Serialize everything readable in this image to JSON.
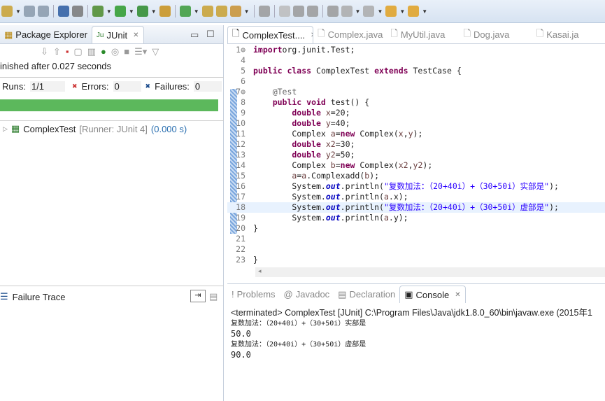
{
  "toolbar": {
    "icons": [
      "new-icon",
      "save-icon",
      "save-all-icon",
      "console-icon",
      "skip-breakpoints-icon",
      "debug-icon",
      "run-icon",
      "coverage-icon",
      "new-package-icon",
      "refresh-icon",
      "open-type-icon",
      "open-folder-icon",
      "tool-icon",
      "pin-icon",
      "search-icon",
      "mark-occurrences-icon",
      "block-selection-icon",
      "show-whitespace-icon",
      "next-annotation-icon",
      "prev-annotation-icon",
      "back-icon",
      "forward-icon"
    ]
  },
  "left": {
    "tabs": [
      {
        "label": "Package Explorer"
      },
      {
        "label": "JUnit"
      }
    ],
    "status": "inished after 0.027 seconds",
    "runs_label": "Runs:",
    "runs": "1/1",
    "errors_label": "Errors:",
    "errors": "0",
    "failures_label": "Failures:",
    "failures": "0",
    "progress": 1.0,
    "progress_color": "#5cb85c",
    "tree_item": {
      "name": "ComplexTest",
      "runner": "[Runner: JUnit 4]",
      "time": "(0.000 s)"
    },
    "failure_trace": "Failure Trace"
  },
  "editor": {
    "tabs": [
      {
        "label": "ComplexTest...."
      },
      {
        "label": "Complex.java"
      },
      {
        "label": "MyUtil.java"
      },
      {
        "label": "Dog.java"
      },
      {
        "label": "Kasai.ja"
      }
    ],
    "highlight_line": "18",
    "lines": [
      {
        "n": "1",
        "s": [
          [
            "kw",
            "import"
          ],
          [
            "",
            "org.junit.Test;"
          ]
        ]
      },
      {
        "n": "4",
        "s": []
      },
      {
        "n": "5",
        "s": [
          [
            "kw",
            "public class"
          ],
          [
            "",
            " ComplexTest "
          ],
          [
            "kw",
            "extends"
          ],
          [
            "",
            " TestCase {"
          ]
        ]
      },
      {
        "n": "6",
        "s": []
      },
      {
        "n": "7",
        "s": [
          [
            "an",
            "    @Test"
          ]
        ]
      },
      {
        "n": "8",
        "s": [
          [
            "kw",
            "    public void"
          ],
          [
            "",
            " test() {"
          ]
        ]
      },
      {
        "n": "9",
        "s": [
          [
            "kw",
            "        double"
          ],
          [
            "vr",
            " x"
          ],
          [
            "",
            "=20;"
          ]
        ]
      },
      {
        "n": "10",
        "s": [
          [
            "kw",
            "        double"
          ],
          [
            "vr",
            " y"
          ],
          [
            "",
            "=40;"
          ]
        ]
      },
      {
        "n": "11",
        "s": [
          [
            "",
            "        Complex "
          ],
          [
            "vr",
            "a"
          ],
          [
            "",
            "="
          ],
          [
            "kw",
            "new"
          ],
          [
            "",
            " Complex("
          ],
          [
            "vr",
            "x"
          ],
          [
            "",
            ","
          ],
          [
            "vr",
            "y"
          ],
          [
            "",
            ");"
          ]
        ]
      },
      {
        "n": "12",
        "s": [
          [
            "kw",
            "        double"
          ],
          [
            "vr",
            " x2"
          ],
          [
            "",
            "=30;"
          ]
        ]
      },
      {
        "n": "13",
        "s": [
          [
            "kw",
            "        double"
          ],
          [
            "vr",
            " y2"
          ],
          [
            "",
            "=50;"
          ]
        ]
      },
      {
        "n": "14",
        "s": [
          [
            "",
            "        Complex "
          ],
          [
            "vr",
            "b"
          ],
          [
            "",
            "="
          ],
          [
            "kw",
            "new"
          ],
          [
            "",
            " Complex("
          ],
          [
            "vr",
            "x2"
          ],
          [
            "",
            ","
          ],
          [
            "vr",
            "y2"
          ],
          [
            "",
            ");"
          ]
        ]
      },
      {
        "n": "15",
        "s": [
          [
            "vr",
            "        a"
          ],
          [
            "",
            "="
          ],
          [
            "vr",
            "a"
          ],
          [
            "",
            ".Complexadd("
          ],
          [
            "vr",
            "b"
          ],
          [
            "",
            ");"
          ]
        ]
      },
      {
        "n": "16",
        "s": [
          [
            "",
            "        System."
          ],
          [
            "fi",
            "out"
          ],
          [
            "",
            ".println("
          ],
          [
            "st",
            "\"复数加法：（20+40i）+（30+50i）实部是\""
          ],
          [
            "",
            ");"
          ]
        ]
      },
      {
        "n": "17",
        "s": [
          [
            "",
            "        System."
          ],
          [
            "fi",
            "out"
          ],
          [
            "",
            ".println("
          ],
          [
            "vr",
            "a"
          ],
          [
            "",
            ".x);"
          ]
        ]
      },
      {
        "n": "18",
        "s": [
          [
            "",
            "        System."
          ],
          [
            "fi",
            "out"
          ],
          [
            "",
            ".println("
          ],
          [
            "st",
            "\"复数加法：（20+40i）+（30+50i）虚部是\""
          ],
          [
            "",
            ");"
          ]
        ]
      },
      {
        "n": "19",
        "s": [
          [
            "",
            "        System."
          ],
          [
            "fi",
            "out"
          ],
          [
            "",
            ".println("
          ],
          [
            "vr",
            "a"
          ],
          [
            "",
            ".y);"
          ]
        ]
      },
      {
        "n": "20",
        "s": [
          [
            "",
            "}"
          ]
        ]
      },
      {
        "n": "21",
        "s": []
      },
      {
        "n": "22",
        "s": []
      },
      {
        "n": "23",
        "s": [
          [
            "",
            "}"
          ]
        ]
      }
    ]
  },
  "bottom": {
    "tabs": [
      {
        "label": "Problems"
      },
      {
        "label": "Javadoc"
      },
      {
        "label": "Declaration"
      },
      {
        "label": "Console"
      }
    ],
    "header": "<terminated> ComplexTest [JUnit] C:\\Program Files\\Java\\jdk1.8.0_60\\bin\\javaw.exe (2015年1",
    "output": [
      "复数加法：（20+40i）+（30+50i）实部是",
      "50.0",
      "复数加法：（20+40i）+（30+50i）虚部是",
      "90.0"
    ]
  }
}
